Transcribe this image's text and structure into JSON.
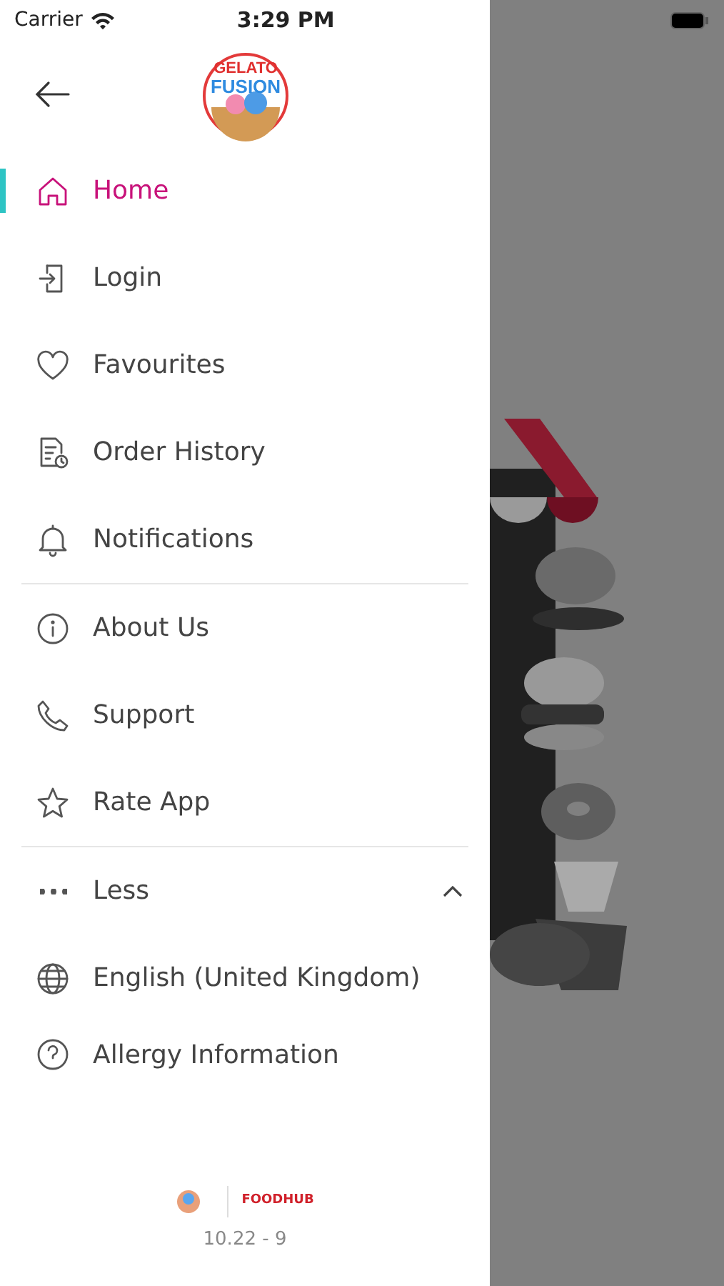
{
  "status_bar": {
    "carrier": "Carrier",
    "time": "3:29 PM"
  },
  "logo": {
    "line1": "GELATO",
    "line2": "FUSION"
  },
  "menu_sections": [
    {
      "items": [
        {
          "kind": "home",
          "label": "Home",
          "selected": true
        },
        {
          "kind": "login",
          "label": "Login",
          "selected": false
        },
        {
          "kind": "heart",
          "label": "Favourites",
          "selected": false
        },
        {
          "kind": "history",
          "label": "Order History",
          "selected": false
        },
        {
          "kind": "bell",
          "label": "Notifications",
          "selected": false
        }
      ]
    },
    {
      "items": [
        {
          "kind": "info",
          "label": "About Us",
          "selected": false
        },
        {
          "kind": "phone",
          "label": "Support",
          "selected": false
        },
        {
          "kind": "star",
          "label": "Rate App",
          "selected": false
        }
      ]
    },
    {
      "items": [
        {
          "kind": "more",
          "label": "Less",
          "selected": false,
          "expanded": true
        },
        {
          "kind": "globe",
          "label": "English (United Kingdom)",
          "selected": false
        },
        {
          "kind": "help",
          "label": "Allergy Information",
          "selected": false
        }
      ]
    }
  ],
  "footer": {
    "brand": "FOODHUB",
    "version": "10.22 - 9"
  }
}
